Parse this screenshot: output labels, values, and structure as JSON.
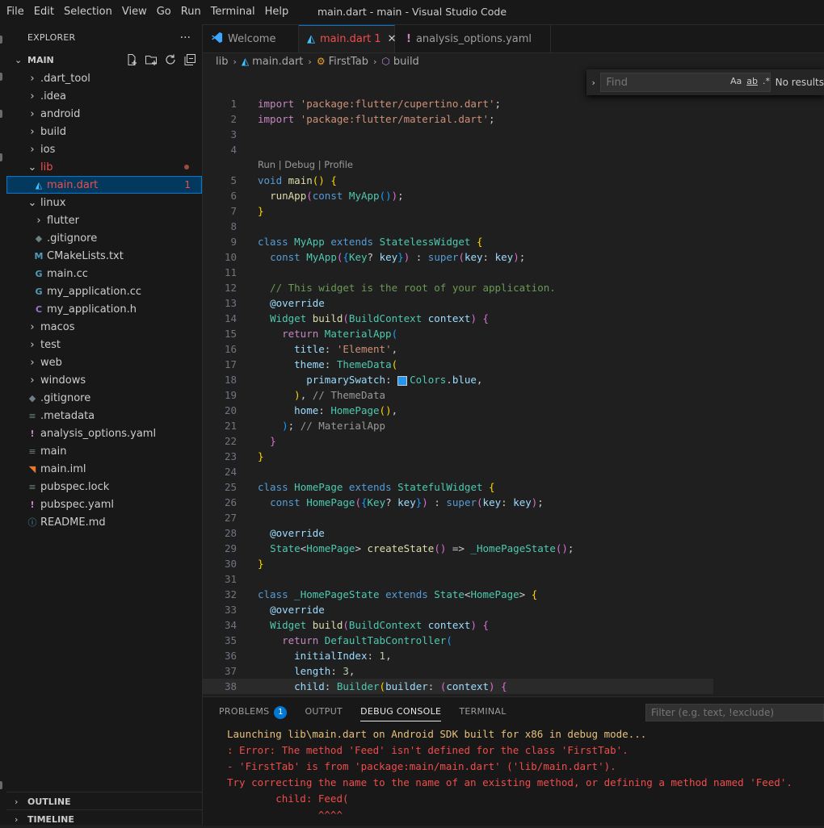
{
  "menu": [
    "File",
    "Edit",
    "Selection",
    "View",
    "Go",
    "Run",
    "Terminal",
    "Help"
  ],
  "window_title": "main.dart - main - Visual Studio Code",
  "sidebar": {
    "title": "EXPLORER",
    "more": "···",
    "root": "MAIN",
    "items": [
      {
        "label": ".dart_tool",
        "type": "folder",
        "depth": 1,
        "icon": "chevron-right"
      },
      {
        "label": ".idea",
        "type": "folder",
        "depth": 1,
        "icon": "chevron-right"
      },
      {
        "label": "android",
        "type": "folder",
        "depth": 1,
        "icon": "chevron-right"
      },
      {
        "label": "build",
        "type": "folder",
        "depth": 1,
        "icon": "chevron-right"
      },
      {
        "label": "ios",
        "type": "folder",
        "depth": 1,
        "icon": "chevron-right"
      },
      {
        "label": "lib",
        "type": "folder-open",
        "depth": 1,
        "icon": "chevron-down",
        "status": "error-dot"
      },
      {
        "label": "main.dart",
        "type": "file",
        "depth": 2,
        "icon": "dart",
        "badge": "1",
        "selected": true
      },
      {
        "label": "linux",
        "type": "folder-open",
        "depth": 1,
        "icon": "chevron-down"
      },
      {
        "label": "flutter",
        "type": "folder",
        "depth": 2,
        "icon": "chevron-right"
      },
      {
        "label": ".gitignore",
        "type": "file",
        "depth": 2,
        "icon": "git"
      },
      {
        "label": "CMakeLists.txt",
        "type": "file",
        "depth": 2,
        "icon": "markdown-m"
      },
      {
        "label": "main.cc",
        "type": "file",
        "depth": 2,
        "icon": "cpp"
      },
      {
        "label": "my_application.cc",
        "type": "file",
        "depth": 2,
        "icon": "cpp"
      },
      {
        "label": "my_application.h",
        "type": "file",
        "depth": 2,
        "icon": "c-header"
      },
      {
        "label": "macos",
        "type": "folder",
        "depth": 1,
        "icon": "chevron-right"
      },
      {
        "label": "test",
        "type": "folder",
        "depth": 1,
        "icon": "chevron-right"
      },
      {
        "label": "web",
        "type": "folder",
        "depth": 1,
        "icon": "chevron-right"
      },
      {
        "label": "windows",
        "type": "folder",
        "depth": 1,
        "icon": "chevron-right"
      },
      {
        "label": ".gitignore",
        "type": "file",
        "depth": 1,
        "icon": "git"
      },
      {
        "label": ".metadata",
        "type": "file",
        "depth": 1,
        "icon": "lines"
      },
      {
        "label": "analysis_options.yaml",
        "type": "file",
        "depth": 1,
        "icon": "exclamation"
      },
      {
        "label": "main",
        "type": "file",
        "depth": 1,
        "icon": "lines"
      },
      {
        "label": "main.iml",
        "type": "file",
        "depth": 1,
        "icon": "rss"
      },
      {
        "label": "pubspec.lock",
        "type": "file",
        "depth": 1,
        "icon": "lines"
      },
      {
        "label": "pubspec.yaml",
        "type": "file",
        "depth": 1,
        "icon": "exclamation"
      },
      {
        "label": "README.md",
        "type": "file",
        "depth": 1,
        "icon": "info"
      }
    ],
    "outline": "OUTLINE",
    "timeline": "TIMELINE"
  },
  "tabs": [
    {
      "label": "Welcome",
      "icon": "vscode-icon",
      "active": false
    },
    {
      "label": "main.dart",
      "badge": "1",
      "icon": "dart-icon",
      "active": true
    },
    {
      "label": "analysis_options.yaml",
      "icon": "exclamation-icon",
      "active": false
    }
  ],
  "breadcrumb": [
    "lib",
    "main.dart",
    "FirstTab",
    "build"
  ],
  "find": {
    "placeholder": "Find",
    "opt_case": "Aa",
    "opt_word": "ab",
    "opt_regex": ".*",
    "result": "No results"
  },
  "code_lens": "Run | Debug | Profile",
  "panel": {
    "tabs": [
      "PROBLEMS",
      "OUTPUT",
      "DEBUG CONSOLE",
      "TERMINAL"
    ],
    "problems_count": "1",
    "filter_placeholder": "Filter (e.g. text, !exclude)",
    "console": [
      {
        "text": "Launching lib\\main.dart on Android SDK built for x86 in debug mode...",
        "level": "warn"
      },
      {
        "text": ": Error: The method 'Feed' isn't defined for the class 'FirstTab'.",
        "level": "error"
      },
      {
        "text": "- 'FirstTab' is from 'package:main/main.dart' ('lib/main.dart').",
        "level": "error"
      },
      {
        "text": "Try correcting the name to the name of an existing method, or defining a method named 'Feed'.",
        "level": "error"
      },
      {
        "text": "        child: Feed(",
        "level": "error"
      },
      {
        "text": "               ^^^^",
        "level": "error"
      }
    ]
  },
  "colors": {
    "accent": "#0078d4",
    "error": "#f14c4c",
    "bg": "#1f1f1f",
    "sidebar": "#181818"
  }
}
